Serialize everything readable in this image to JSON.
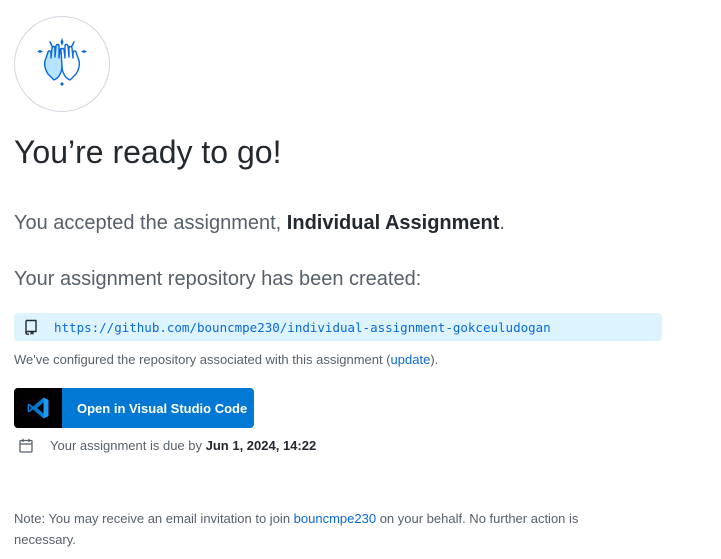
{
  "hero": {
    "icon": "high-five-icon",
    "headline": "You’re ready to go!"
  },
  "accepted": {
    "prefix": "You accepted the assignment, ",
    "assignment_name": "Individual Assignment",
    "suffix": "."
  },
  "repo": {
    "created_label": "Your assignment repository has been created:",
    "icon": "repo-icon",
    "url": "https://github.com/bouncmpe230/individual-assignment-gokceuludogan"
  },
  "configured": {
    "prefix": "We've configured the repository associated with this assignment (",
    "link": "update",
    "suffix": ")."
  },
  "vscode_button": {
    "icon": "vscode-icon",
    "label": "Open in Visual Studio Code"
  },
  "due": {
    "icon": "calendar-icon",
    "prefix": "Your assignment is due by ",
    "date": "Jun 1, 2024, 14:22"
  },
  "note": {
    "prefix": "Note: You may receive an email invitation to join ",
    "org_link": "bouncmpe230",
    "suffix": " on your behalf. No further action is necessary."
  },
  "colors": {
    "link": "#0969da",
    "repo_box_bg": "#ddf4ff",
    "vscode_blue": "#0078d4",
    "text_primary": "#24292f",
    "text_muted": "#57606a",
    "icon_accent": "#54aeff"
  }
}
